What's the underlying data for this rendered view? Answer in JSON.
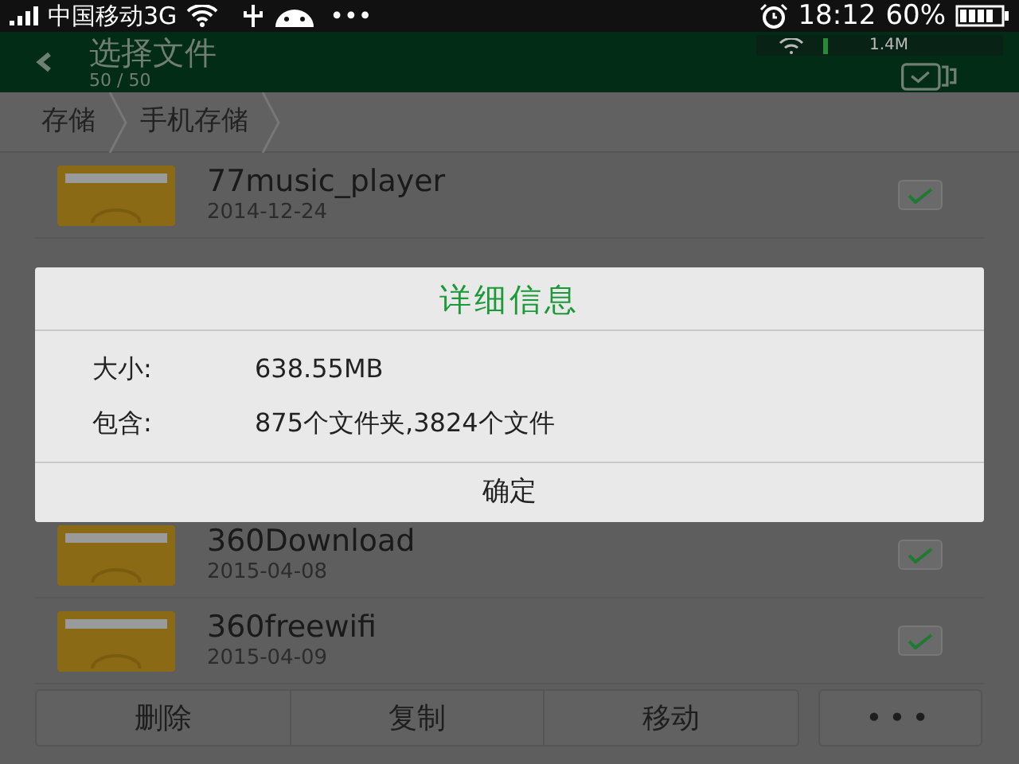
{
  "status_bar": {
    "carrier": "中国移动3G",
    "dots": "•••",
    "time": "18:12",
    "battery": "60%"
  },
  "header": {
    "title": "选择文件",
    "count": "50 / 50",
    "speed": "1.4M"
  },
  "breadcrumb": [
    "存储",
    "手机存储"
  ],
  "files_top": [
    {
      "name": "77music_player",
      "date": "2014-12-24",
      "checked": true
    }
  ],
  "files_bottom": [
    {
      "name": "360Download",
      "date": "2015-04-08",
      "checked": true
    },
    {
      "name": "360freewifi",
      "date": "2015-04-09",
      "checked": true
    }
  ],
  "dialog": {
    "title": "详细信息",
    "rows": [
      {
        "label": "大小:",
        "value": "638.55MB"
      },
      {
        "label": "包含:",
        "value": "875个文件夹,3824个文件"
      }
    ],
    "button": "确定"
  },
  "actions": [
    "删除",
    "复制",
    "移动"
  ],
  "more": "•••"
}
